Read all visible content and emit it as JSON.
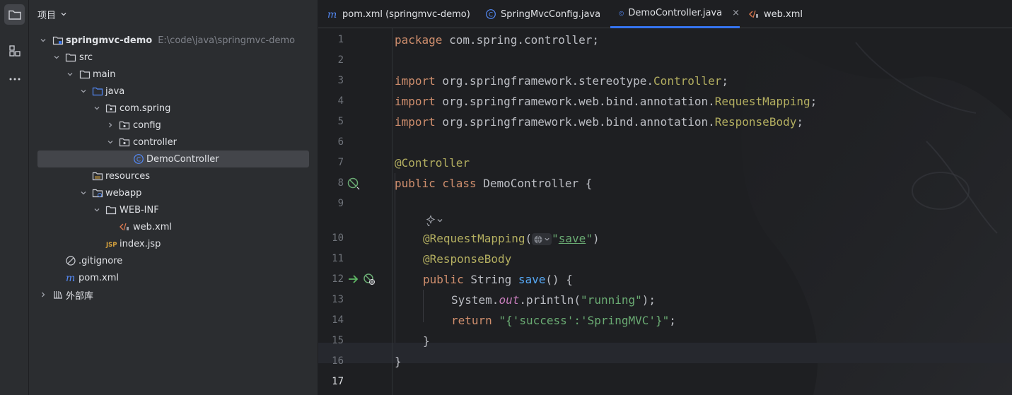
{
  "project_panel": {
    "title": "项目",
    "tree": [
      {
        "label": "springmvc-demo",
        "path": "E:\\code\\java\\springmvc-demo"
      },
      {
        "label": "src"
      },
      {
        "label": "main"
      },
      {
        "label": "java"
      },
      {
        "label": "com.spring"
      },
      {
        "label": "config"
      },
      {
        "label": "controller"
      },
      {
        "label": "DemoController"
      },
      {
        "label": "resources"
      },
      {
        "label": "webapp"
      },
      {
        "label": "WEB-INF"
      },
      {
        "label": "web.xml"
      },
      {
        "label": "index.jsp"
      },
      {
        "label": ".gitignore"
      },
      {
        "label": "pom.xml"
      },
      {
        "label": "外部库"
      }
    ]
  },
  "tabs": [
    {
      "label": "pom.xml (springmvc-demo)",
      "icon": "maven-icon"
    },
    {
      "label": "SpringMvcConfig.java",
      "icon": "java-class-icon"
    },
    {
      "label": "DemoController.java",
      "icon": "java-class-icon",
      "active": true,
      "close": "×"
    },
    {
      "label": "web.xml",
      "icon": "xml-icon"
    }
  ],
  "editor": {
    "lines": {
      "n1": "1",
      "n2": "2",
      "n3": "3",
      "n4": "4",
      "n5": "5",
      "n6": "6",
      "n7": "7",
      "n8": "8",
      "n9": "9",
      "n10": "10",
      "n11": "11",
      "n12": "12",
      "n13": "13",
      "n14": "14",
      "n15": "15",
      "n16": "16",
      "n17": "17"
    },
    "code": {
      "l1_kw": "package",
      "l1_rest": " com.spring.controller;",
      "l3_kw": "import",
      "l3_pkg": " org.springframework.stereotype.",
      "l3_cls": "Controller",
      "l3_end": ";",
      "l4_kw": "import",
      "l4_pkg": " org.springframework.web.bind.annotation.",
      "l4_cls": "RequestMapping",
      "l4_end": ";",
      "l5_kw": "import",
      "l5_pkg": " org.springframework.web.bind.annotation.",
      "l5_cls": "ResponseBody",
      "l5_end": ";",
      "l7_ann": "@Controller",
      "l8_kw1": "public",
      "l8_kw2": " class",
      "l8_rest": " DemoController {",
      "l10_ann": "@RequestMapping",
      "l10_open": "(",
      "l10_q1": "\"",
      "l10_str": "save",
      "l10_q2": "\"",
      "l10_close": ")",
      "l11_ann": "@ResponseBody",
      "l12_kw": "public",
      "l12_type": " String ",
      "l12_fn": "save",
      "l12_rest": "() {",
      "l13_a": "System.",
      "l13_out": "out",
      "l13_b": ".println(",
      "l13_str": "\"running\"",
      "l13_c": ");",
      "l14_kw": "return",
      "l14_str": " \"{'success':'SpringMVC'}\"",
      "l14_end": ";",
      "l15": "}",
      "l16": "}"
    }
  },
  "colors": {
    "accent": "#3574f0",
    "keyword": "#cf8e6d",
    "annotation": "#b3ae60",
    "string": "#6aab73",
    "function": "#56a8f5"
  }
}
